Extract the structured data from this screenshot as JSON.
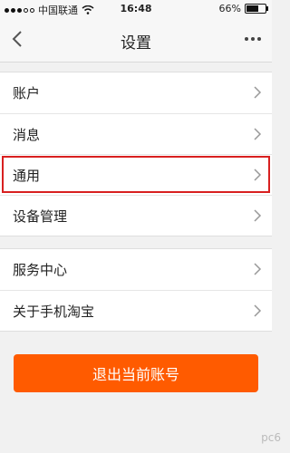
{
  "status_bar": {
    "carrier": "中国联通",
    "time": "16:48",
    "battery": "66%",
    "battery_level": 0.66
  },
  "nav": {
    "title": "设置"
  },
  "group1": [
    {
      "label": "账户"
    },
    {
      "label": "消息"
    },
    {
      "label": "通用"
    },
    {
      "label": "设备管理"
    }
  ],
  "group2": [
    {
      "label": "服务中心"
    },
    {
      "label": "关于手机淘宝"
    }
  ],
  "logout_label": "退出当前账号",
  "watermark": "pc6"
}
